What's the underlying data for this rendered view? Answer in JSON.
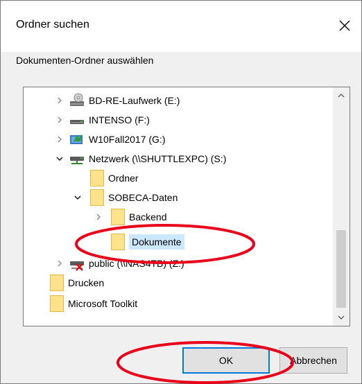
{
  "dialog": {
    "title": "Ordner suchen",
    "subtitle": "Dokumenten-Ordner auswählen"
  },
  "tree": {
    "items": [
      {
        "label": "BD-RE-Laufwerk (E:)",
        "expander": "collapsed",
        "icon": "optical-drive-icon"
      },
      {
        "label": "INTENSO (F:)",
        "expander": "collapsed",
        "icon": "drive-icon"
      },
      {
        "label": "W10Fall2017 (G:)",
        "expander": "collapsed",
        "icon": "usb-drive-icon"
      },
      {
        "label": "Netzwerk (\\\\SHUTTLEXPC) (S:)",
        "expander": "expanded",
        "icon": "network-drive-icon"
      },
      {
        "label": "Ordner",
        "expander": "none",
        "icon": "folder-icon"
      },
      {
        "label": "SOBECA-Daten",
        "expander": "expanded",
        "icon": "folder-icon"
      },
      {
        "label": "Backend",
        "expander": "collapsed",
        "icon": "folder-icon"
      },
      {
        "label": "Dokumente",
        "expander": "none",
        "icon": "folder-icon",
        "selected": true
      },
      {
        "label": "public (\\\\NAS4TB) (Z:)",
        "expander": "collapsed",
        "icon": "disconnected-network-drive-icon"
      },
      {
        "label": "Drucken",
        "expander": "none",
        "icon": "folder-icon"
      },
      {
        "label": "Microsoft Toolkit",
        "expander": "none",
        "icon": "folder-icon"
      }
    ]
  },
  "buttons": {
    "ok": "OK",
    "cancel": "Abbrechen"
  },
  "colors": {
    "selection": "#cce8ff",
    "folder": "#ffe38c",
    "annotation": "#e8001a",
    "focus": "#0078d7"
  }
}
